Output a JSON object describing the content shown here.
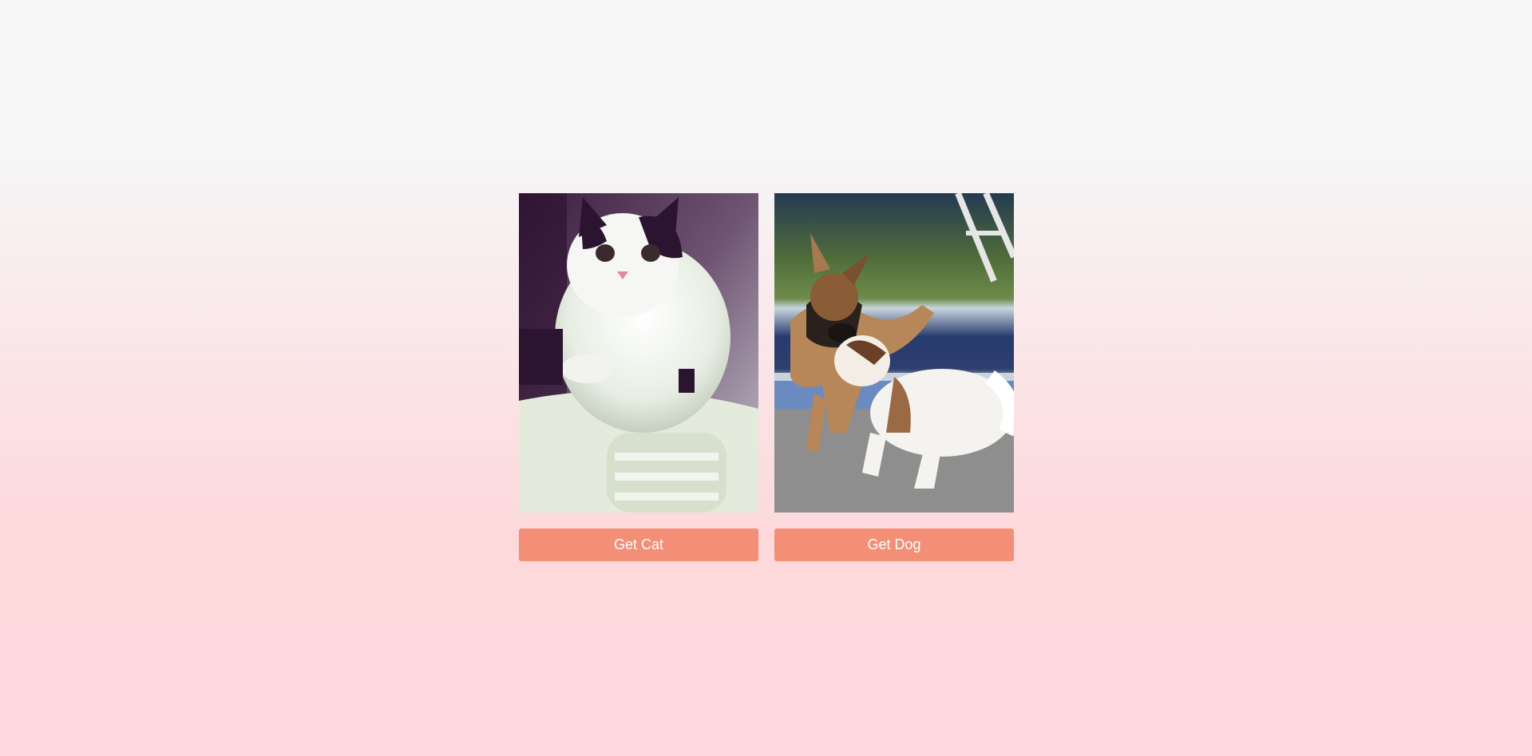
{
  "theme": {
    "button_color": "#f38e77",
    "button_text_color": "#ffffff"
  },
  "cards": [
    {
      "image_icon": "cat-photo",
      "button_label": "Get Cat"
    },
    {
      "image_icon": "dog-photo",
      "button_label": "Get Dog"
    }
  ]
}
